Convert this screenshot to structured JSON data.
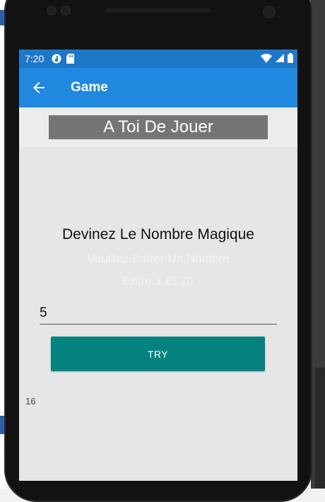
{
  "status_bar": {
    "time": "7:20"
  },
  "app_bar": {
    "title": "Game",
    "back_icon": "arrow-back-icon"
  },
  "banner": {
    "text": "A Toi De Jouer"
  },
  "main": {
    "prompt": "Devinez Le Nombre Magique",
    "hint_line1": "Veuillez Entrer Un Nombre",
    "hint_line2": "Entre 1 Et 20",
    "guess_value": "5",
    "try_label": "TRY",
    "result_text": "16"
  },
  "colors": {
    "status_bar": "#1e78c8",
    "app_bar": "#2188e0",
    "button": "#04827f",
    "banner": "#757575",
    "screen_bg": "#e6e6e6"
  }
}
